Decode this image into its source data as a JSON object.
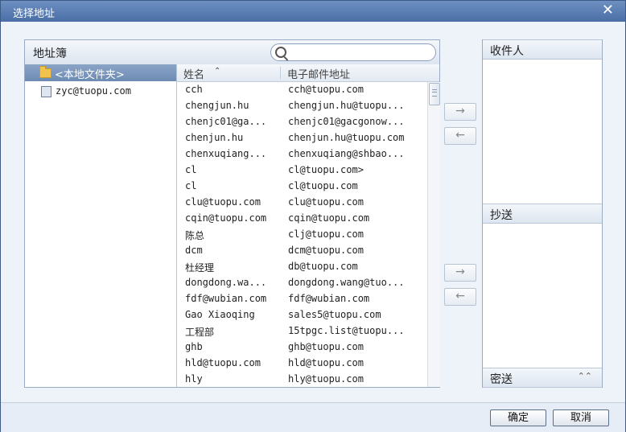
{
  "window": {
    "title": "选择地址",
    "close_glyph": "✕"
  },
  "address_book": {
    "title": "地址簿",
    "search_placeholder": "",
    "folders": {
      "local_label": "<本地文件夹>",
      "account_label": "zyc@tuopu.com"
    },
    "columns": {
      "name": "姓名",
      "sort_glyph": "⌃",
      "email": "电子邮件地址"
    },
    "scroll_grip": "≡",
    "contacts": [
      {
        "name": "cch",
        "email": "cch@tuopu.com"
      },
      {
        "name": "chengjun.hu",
        "email": "chengjun.hu@tuopu..."
      },
      {
        "name": "chenjc01@ga...",
        "email": "chenjc01@gacgonow..."
      },
      {
        "name": "chenjun.hu",
        "email": "chenjun.hu@tuopu.com"
      },
      {
        "name": "chenxuqiang...",
        "email": "chenxuqiang@shbao..."
      },
      {
        "name": "cl",
        "email": "cl@tuopu.com>"
      },
      {
        "name": "cl",
        "email": "cl@tuopu.com"
      },
      {
        "name": "clu@tuopu.com",
        "email": "clu@tuopu.com"
      },
      {
        "name": "cqin@tuopu.com",
        "email": "cqin@tuopu.com"
      },
      {
        "name": "陈总",
        "email": "clj@tuopu.com"
      },
      {
        "name": "dcm",
        "email": "dcm@tuopu.com"
      },
      {
        "name": "杜经理",
        "email": "db@tuopu.com"
      },
      {
        "name": "dongdong.wa...",
        "email": "dongdong.wang@tuo..."
      },
      {
        "name": "fdf@wubian.com",
        "email": "fdf@wubian.com"
      },
      {
        "name": "Gao Xiaoqing",
        "email": "sales5@tuopu.com"
      },
      {
        "name": "工程部",
        "email": "15tpgc.list@tuopu..."
      },
      {
        "name": "ghb",
        "email": "ghb@tuopu.com"
      },
      {
        "name": "hld@tuopu.com",
        "email": "hld@tuopu.com"
      },
      {
        "name": "hly",
        "email": "hly@tuopu.com"
      }
    ]
  },
  "transfer": {
    "add_glyph": "→",
    "remove_glyph": "←"
  },
  "recipients": {
    "to_label": "收件人",
    "cc_label": "抄送",
    "bcc_label": "密送",
    "expand_glyph": "⌃⌃"
  },
  "footer": {
    "ok_label": "确定",
    "cancel_label": "取消"
  }
}
